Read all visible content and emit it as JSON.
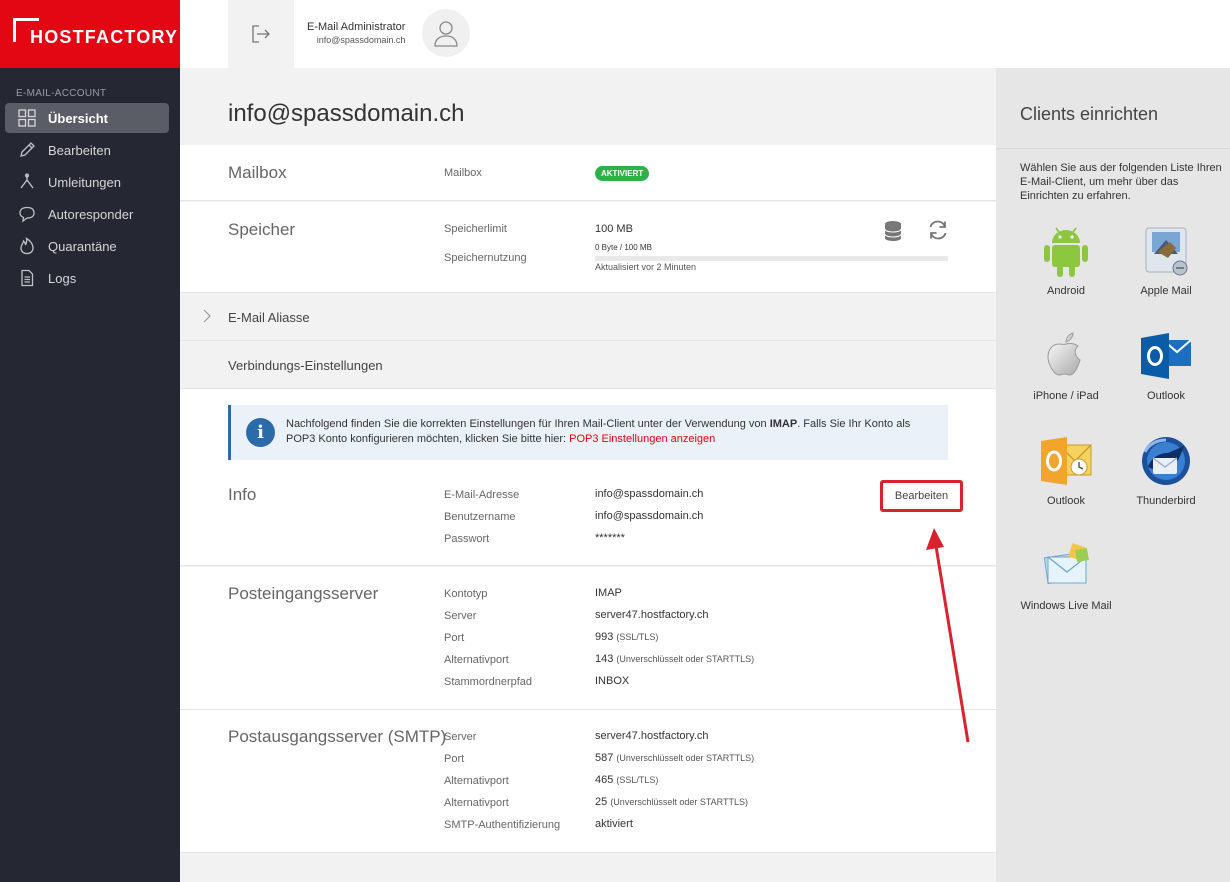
{
  "brand": {
    "logo_text": "HOSTFACTORY",
    "color": "#e30613"
  },
  "sidebar": {
    "section": "E-MAIL-ACCOUNT",
    "items": [
      {
        "label": "Übersicht",
        "icon": "grid-icon",
        "active": true
      },
      {
        "label": "Bearbeiten",
        "icon": "pencil-icon",
        "active": false
      },
      {
        "label": "Umleitungen",
        "icon": "fork-icon",
        "active": false
      },
      {
        "label": "Autoresponder",
        "icon": "speech-bubble-icon",
        "active": false
      },
      {
        "label": "Quarantäne",
        "icon": "flame-icon",
        "active": false
      },
      {
        "label": "Logs",
        "icon": "document-icon",
        "active": false
      }
    ]
  },
  "topbar": {
    "user_name": "E-Mail Administrator",
    "user_email": "info@spassdomain.ch"
  },
  "page": {
    "title": "info@spassdomain.ch"
  },
  "mailbox": {
    "title": "Mailbox",
    "label": "Mailbox",
    "status": "AKTIVIERT"
  },
  "storage": {
    "title": "Speicher",
    "limit_label": "Speicherlimit",
    "limit_value": "100 MB",
    "usage_label": "Speichernutzung",
    "usage_value": "0 Byte / 100 MB",
    "usage_fraction": 0,
    "updated": "Aktualisiert vor 2 Minuten"
  },
  "aliases": {
    "title": "E-Mail Aliasse"
  },
  "connection": {
    "title": "Verbindungs-Einstellungen"
  },
  "notice": {
    "text_before": "Nachfolgend finden Sie die korrekten Einstellungen für Ihren Mail-Client unter der Verwendung von ",
    "bold": "IMAP",
    "text_after": ". Falls Sie Ihr Konto als POP3 Konto konfigurieren möchten, klicken Sie bitte hier: ",
    "link": "POP3 Einstellungen anzeigen"
  },
  "info": {
    "title": "Info",
    "edit_button": "Bearbeiten",
    "rows": [
      {
        "label": "E-Mail-Adresse",
        "value": "info@spassdomain.ch"
      },
      {
        "label": "Benutzername",
        "value": "info@spassdomain.ch"
      },
      {
        "label": "Passwort",
        "value": "*******"
      }
    ]
  },
  "incoming": {
    "title": "Posteingangsserver",
    "rows": [
      {
        "label": "Kontotyp",
        "value": "IMAP",
        "note": ""
      },
      {
        "label": "Server",
        "value": "server47.hostfactory.ch",
        "note": ""
      },
      {
        "label": "Port",
        "value": "993",
        "note": "(SSL/TLS)"
      },
      {
        "label": "Alternativport",
        "value": "143",
        "note": "(Unverschlüsselt oder STARTTLS)"
      },
      {
        "label": "Stammordnerpfad",
        "value": "INBOX",
        "note": ""
      }
    ]
  },
  "outgoing": {
    "title": "Postausgangsserver (SMTP)",
    "rows": [
      {
        "label": "Server",
        "value": "server47.hostfactory.ch",
        "note": ""
      },
      {
        "label": "Port",
        "value": "587",
        "note": "(Unverschlüsselt oder STARTTLS)"
      },
      {
        "label": "Alternativport",
        "value": "465",
        "note": "(SSL/TLS)"
      },
      {
        "label": "Alternativport",
        "value": "25",
        "note": "(Unverschlüsselt oder STARTTLS)"
      },
      {
        "label": "SMTP-Authentifizierung",
        "value": "aktiviert",
        "note": ""
      }
    ]
  },
  "clients": {
    "title": "Clients einrichten",
    "description": "Wählen Sie aus der folgenden Liste Ihren E-Mail-Client, um mehr über das Einrichten zu erfahren.",
    "items": [
      {
        "label": "Android",
        "icon": "android-icon"
      },
      {
        "label": "Apple Mail",
        "icon": "apple-mail-icon"
      },
      {
        "label": "iPhone / iPad",
        "icon": "apple-icon"
      },
      {
        "label": "Outlook",
        "icon": "outlook-icon"
      },
      {
        "label": "Outlook",
        "icon": "outlook-legacy-icon"
      },
      {
        "label": "Thunderbird",
        "icon": "thunderbird-icon"
      },
      {
        "label": "Windows Live Mail",
        "icon": "windows-live-mail-icon"
      }
    ]
  }
}
